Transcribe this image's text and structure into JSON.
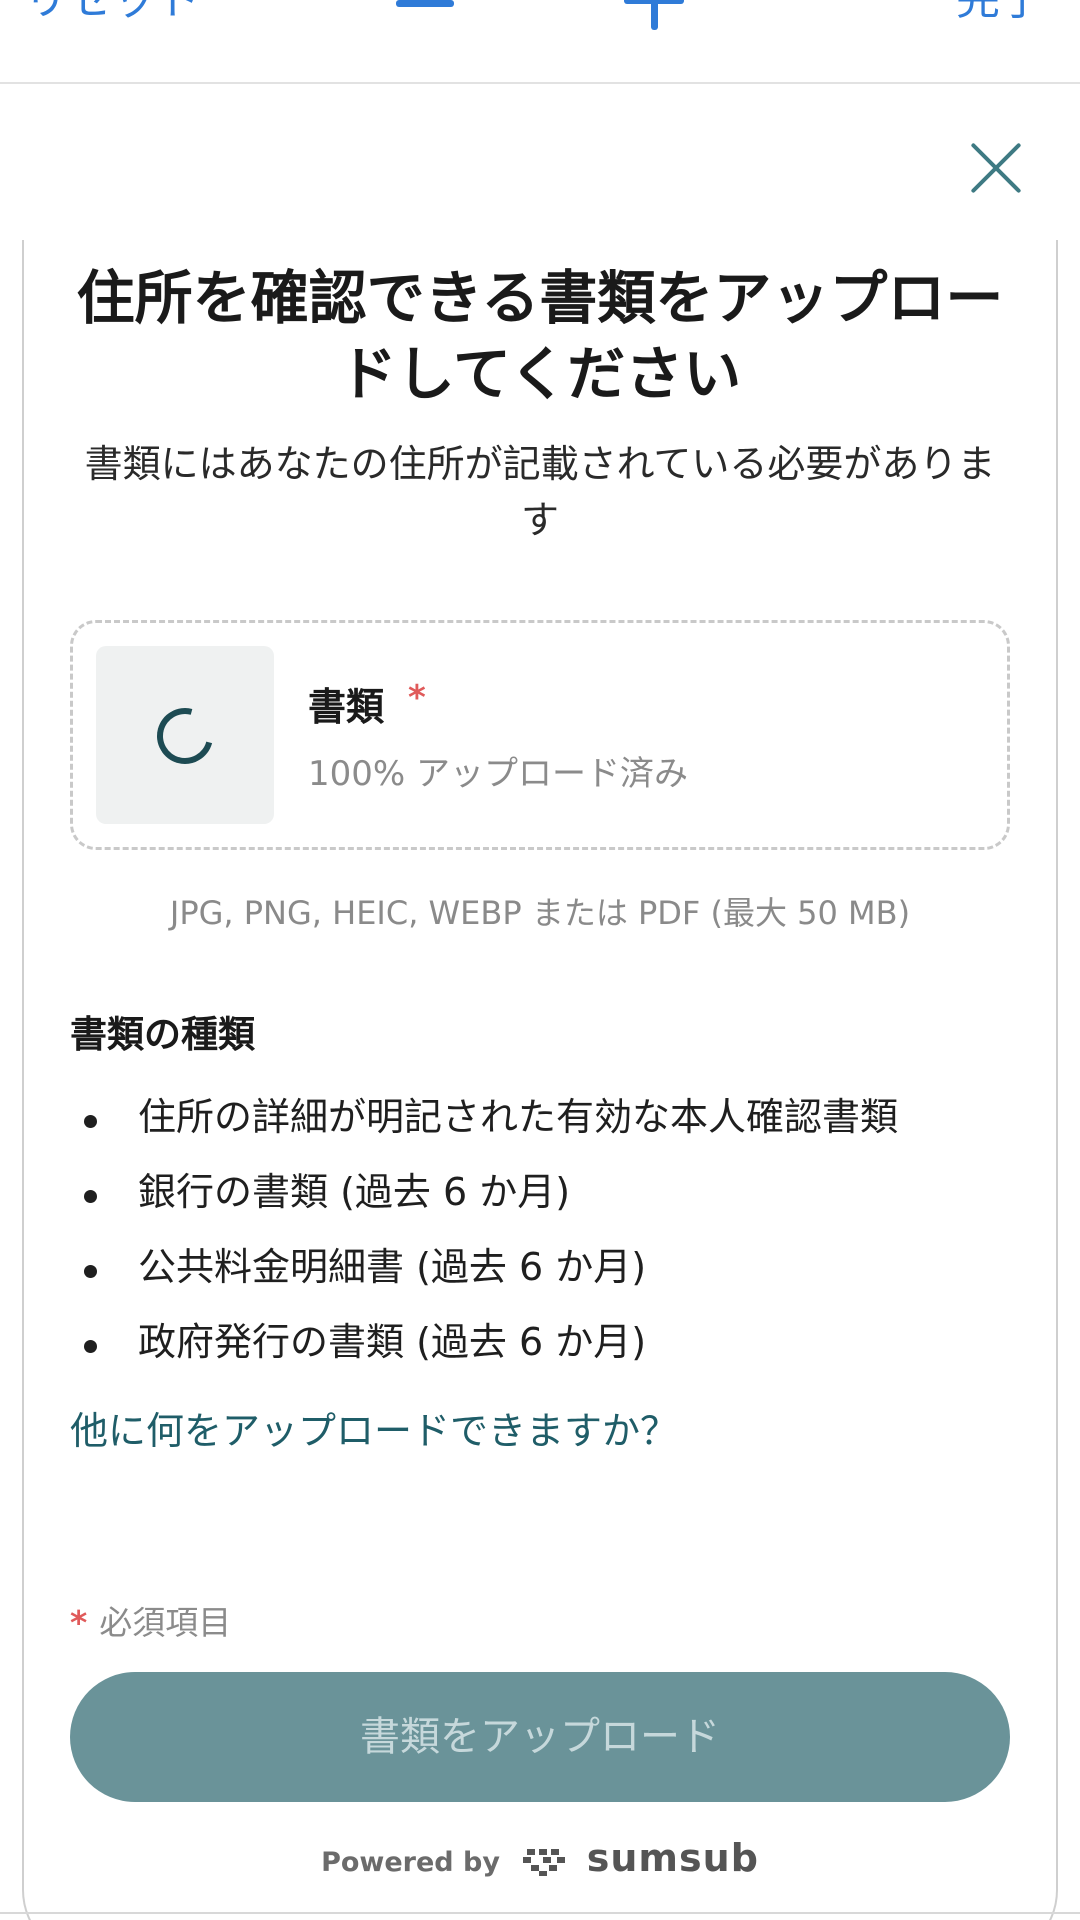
{
  "toolbar": {
    "reset_label": "リセット",
    "done_label": "完了"
  },
  "title": "住所を確認できる書類をアップロードしてください",
  "subtitle": "書類にはあなたの住所が記載されている必要があります",
  "upload": {
    "label": "書類",
    "required_mark": "*",
    "status": "100% アップロード済み",
    "formats": "JPG, PNG, HEIC, WEBP または PDF (最大 50 MB)"
  },
  "document_types": {
    "heading": "書類の種類",
    "items": [
      "住所の詳細が明記された有効な本人確認書類",
      "銀行の書類 (過去 6 か月)",
      "公共料金明細書 (過去 6 か月)",
      "政府発行の書類 (過去 6 か月)"
    ]
  },
  "more_link": "他に何をアップロードできますか？",
  "required_note": {
    "mark": "*",
    "text": "必須項目"
  },
  "upload_button": "書類をアップロード",
  "footer": {
    "powered_by": "Powered by",
    "brand": "sumsub"
  },
  "colors": {
    "accent": "#2f7bd8",
    "primary": "#6a9399",
    "link": "#1f5d68",
    "required": "#e05a5a"
  }
}
